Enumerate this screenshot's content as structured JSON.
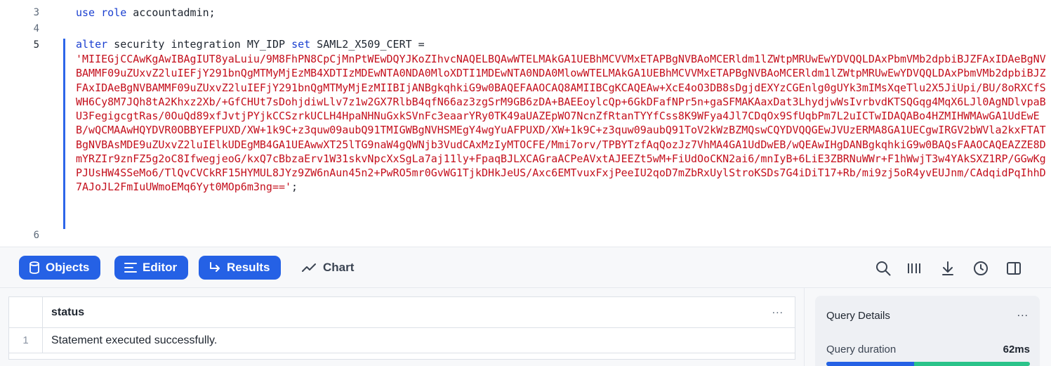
{
  "editor": {
    "line_numbers": [
      "3",
      "4",
      "5",
      "6"
    ],
    "line3": {
      "kw": "use role",
      "rest": " accountadmin;"
    },
    "line5": {
      "kw1": "alter",
      "t1": " security integration MY_IDP ",
      "kw2": "set",
      "t2": " SAML2_X509_CERT =",
      "cert": "'MIIEGjCCAwKgAwIBAgIUT8yaLuiu/9M8FhPN8CpCjMnPtWEwDQYJKoZIhvcNAQELBQAwWTELMAkGA1UEBhMCVVMxETAPBgNVBAoMCERldm1lZWtpMRUwEwYDVQQLDAxPbmVMb2dpbiBJZFAxIDAeBgNVBAMMF09uZUxvZ2luIEFjY291bnQgMTMyMjEzMB4XDTIzMDEwNTA0NDA0MloXDTI1MDEwNTA0NDA0MlowWTELMAkGA1UEBhMCVVMxETAPBgNVBAoMCERldm1lZWtpMRUwEwYDVQQLDAxPbmVMb2dpbiBJZFAxIDAeBgNVBAMMF09uZUxvZ2luIEFjY291bnQgMTMyMjEzMIIBIjANBgkqhkiG9w0BAQEFAAOCAQ8AMIIBCgKCAQEAw+XcE4oO3DB8sDgjdEXYzCGEnlg0gUYk3mIMsXqeTlu2X5JiUpi/BU/8oRXCfSWH6Cy8M7JQh8tA2Khxz2Xb/+GfCHUt7sDohjdiwLlv7z1w2GX7RlbB4qfN66az3zgSrM9GB6zDA+BAEEoylcQp+6GkDFafNPr5n+gaSFMAKAaxDat3LhydjwWsIvrbvdKTSQGqg4MqX6LJl0AgNDlvpaBU3FegigcgtRas/0OuQd89xfJvtjPYjkCCSzrkUCLH4HpaNHNuGxkSVnFc3eaarYRy0TK49aUAZEpWO7NcnZfRtanTYYfCss8K9WFya4Jl7CDqOx9SfUqbPm7L2uICTwIDAQABo4HZMIHWMAwGA1UdEwEB/wQCMAAwHQYDVR0OBBYEFPUXD/XW+1k9C+z3quw09aubQ91TMIGWBgNVHSMEgY4wgYuAFPUXD/XW+1k9C+z3quw09aubQ91ToV2kWzBZMQswCQYDVQQGEwJVUzERMA8GA1UECgwIRGV2bWVla2kxFTATBgNVBAsMDE9uZUxvZ2luIElkUDEgMB4GA1UEAwwXT25lTG9naW4gQWNjb3VudCAxMzIyMTOCFE/Mmi7orv/TPBYTzfAqQozJz7VhMA4GA1UdDwEB/wQEAwIHgDANBgkqhkiG9w0BAQsFAAOCAQEAZZE8DmYRZIr9znFZ5g2oC8IfwegjeoG/kxQ7cBbzaErv1W31skvNpcXxSgLa7aj11ly+FpaqBJLXCAGraACPeAVxtAJEEZt5wM+FiUdOoCKN2ai6/mnIyB+6LiE3ZBRNuWWr+F1hWwjT3w4YAkSXZ1RP/GGwKgPJUsHW4SSeMo6/TlQvCVCkRF15HYMUL8JYz9ZW6nAun45n2+PwRO5mr0GvWG1TjkDHkJeUS/Axc6EMTvuxFxjPeeIU2qoD7mZbRxUylStroKSDs7G4iDiT17+Rb/mi9zj5oR4yvEUJnm/CAdqidPqIhhD7AJoJL2FmIuUWmoEMq6Yyt0MOp6m3ng=='",
      "end": ";"
    }
  },
  "toolbar": {
    "objects_label": "Objects",
    "editor_label": "Editor",
    "results_label": "Results",
    "chart_label": "Chart"
  },
  "results": {
    "column_header": "status",
    "more_label": "...",
    "rows": [
      {
        "index": "1",
        "status": "Statement executed successfully."
      }
    ]
  },
  "query_details": {
    "title": "Query Details",
    "more_label": "...",
    "duration_label": "Query duration",
    "duration_value": "62ms",
    "bar_compile_fraction": 0.43
  },
  "colors": {
    "accent": "#2561e5",
    "keyword": "#1a3fd0",
    "string": "#c4101d",
    "success": "#2bc38a"
  }
}
